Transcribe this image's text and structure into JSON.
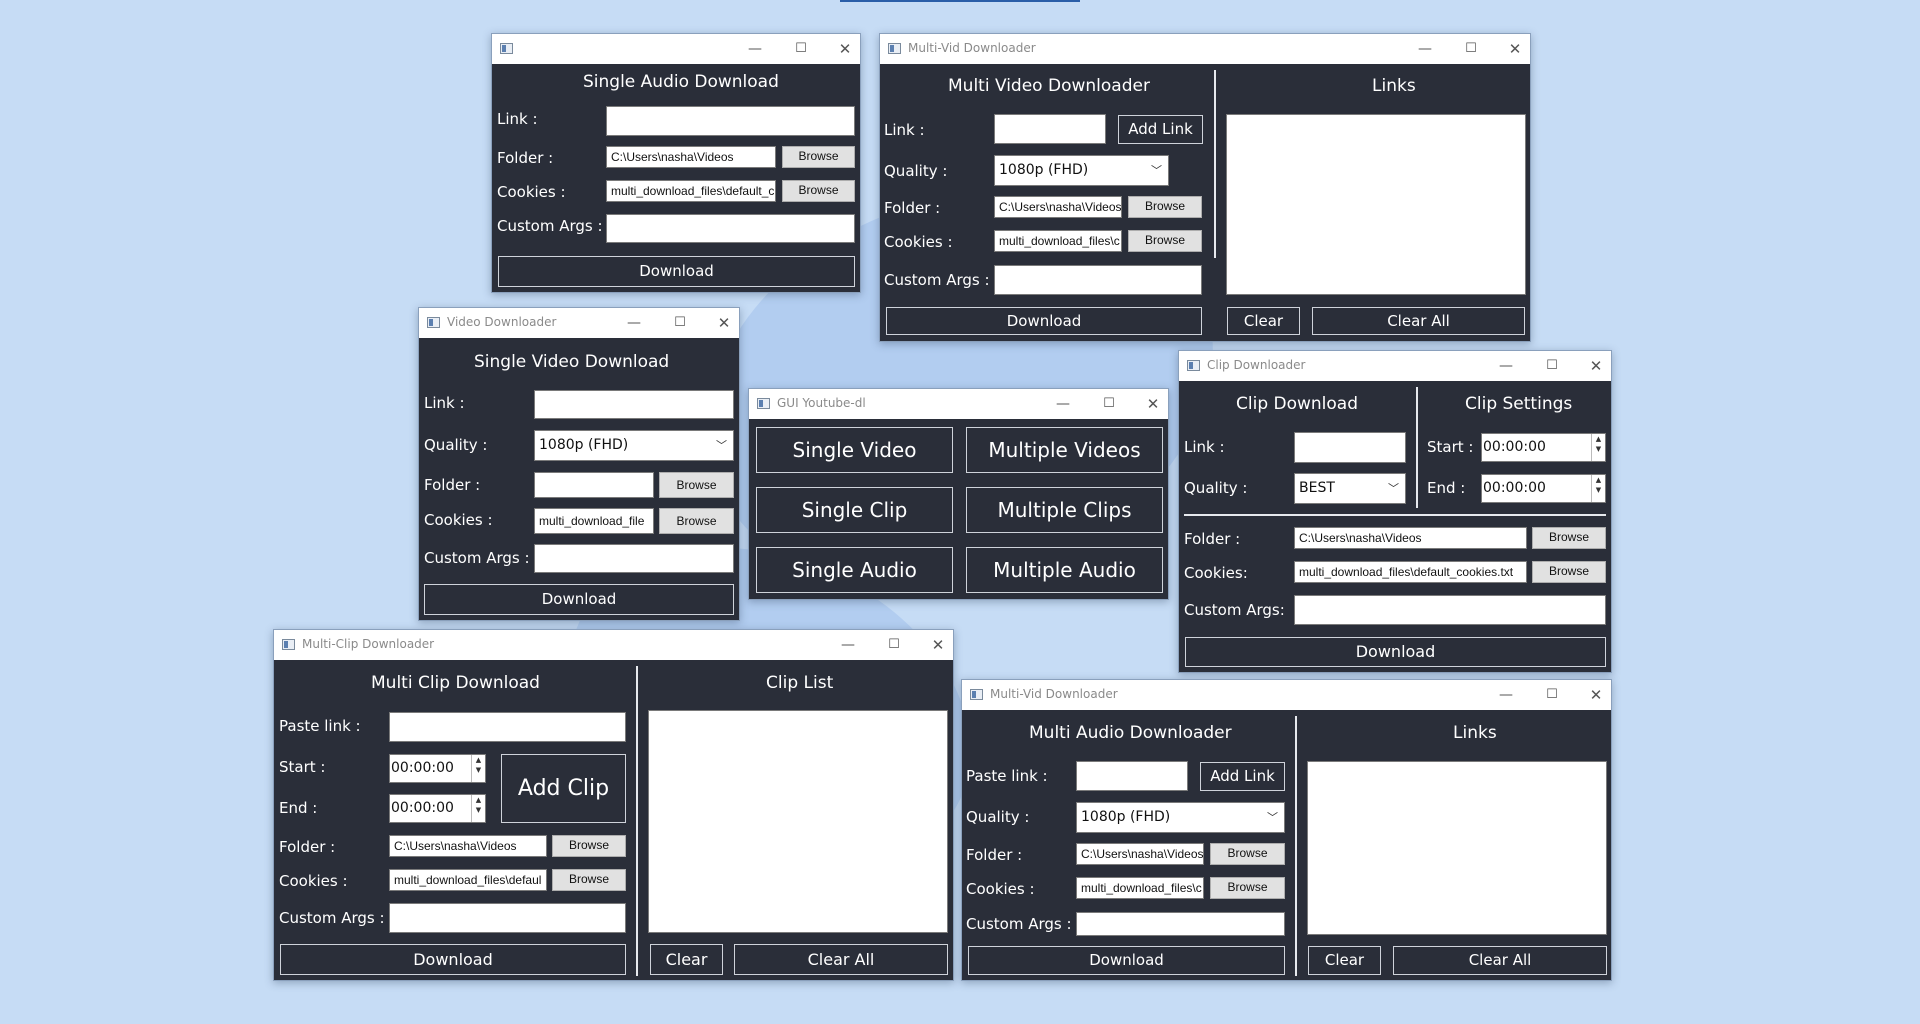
{
  "common": {
    "link_label": "Link :",
    "quality_label": "Quality :",
    "folder_label": "Folder :",
    "cookies_label": "Cookies :",
    "cookies_colon_label": "Cookies:",
    "custom_args_label": "Custom Args :",
    "custom_args_colon_label": "Custom Args:",
    "browse": "Browse",
    "download": "Download",
    "add_link": "Add Link",
    "clear": "Clear",
    "clear_all": "Clear All",
    "paste_link_label": "Paste link :",
    "start_label": "Start :",
    "end_label": "End :",
    "links_header": "Links"
  },
  "windows": {
    "single_audio": {
      "title": "",
      "header": "Single Audio Download",
      "folder_value": "C:\\Users\\nasha\\Videos",
      "cookies_value": "multi_download_files\\default_c"
    },
    "multi_vid": {
      "title": "Multi-Vid Downloader",
      "header": "Multi Video Downloader",
      "quality_value": "1080p (FHD)",
      "folder_value": "C:\\Users\\nasha\\Videos",
      "cookies_value": "multi_download_files\\c"
    },
    "video": {
      "title": "Video Downloader",
      "header": "Single Video Download",
      "quality_value": "1080p (FHD)",
      "cookies_value": "multi_download_file"
    },
    "gui": {
      "title": "GUI Youtube-dl",
      "buttons": [
        "Single Video",
        "Multiple Videos",
        "Single Clip",
        "Multiple Clips",
        "Single Audio",
        "Multiple Audio"
      ]
    },
    "clip": {
      "title": "Clip Downloader",
      "header": "Clip Download",
      "settings_header": "Clip Settings",
      "quality_value": "BEST",
      "start_value": "00:00:00",
      "end_value": "00:00:00",
      "folder_value": "C:\\Users\\nasha\\Videos",
      "cookies_value": "multi_download_files\\default_cookies.txt"
    },
    "multi_clip": {
      "title": "Multi-Clip Downloader",
      "header": "Multi Clip Download",
      "list_header": "Clip List",
      "start_value": "00:00:00",
      "end_value": "00:00:00",
      "add_clip": "Add Clip",
      "folder_value": "C:\\Users\\nasha\\Videos",
      "cookies_value": "multi_download_files\\defaul"
    },
    "multi_audio": {
      "title": "Multi-Vid Downloader",
      "header": "Multi Audio Downloader",
      "quality_value": "1080p (FHD)",
      "folder_value": "C:\\Users\\nasha\\Videos",
      "cookies_value": "multi_download_files\\c"
    }
  }
}
